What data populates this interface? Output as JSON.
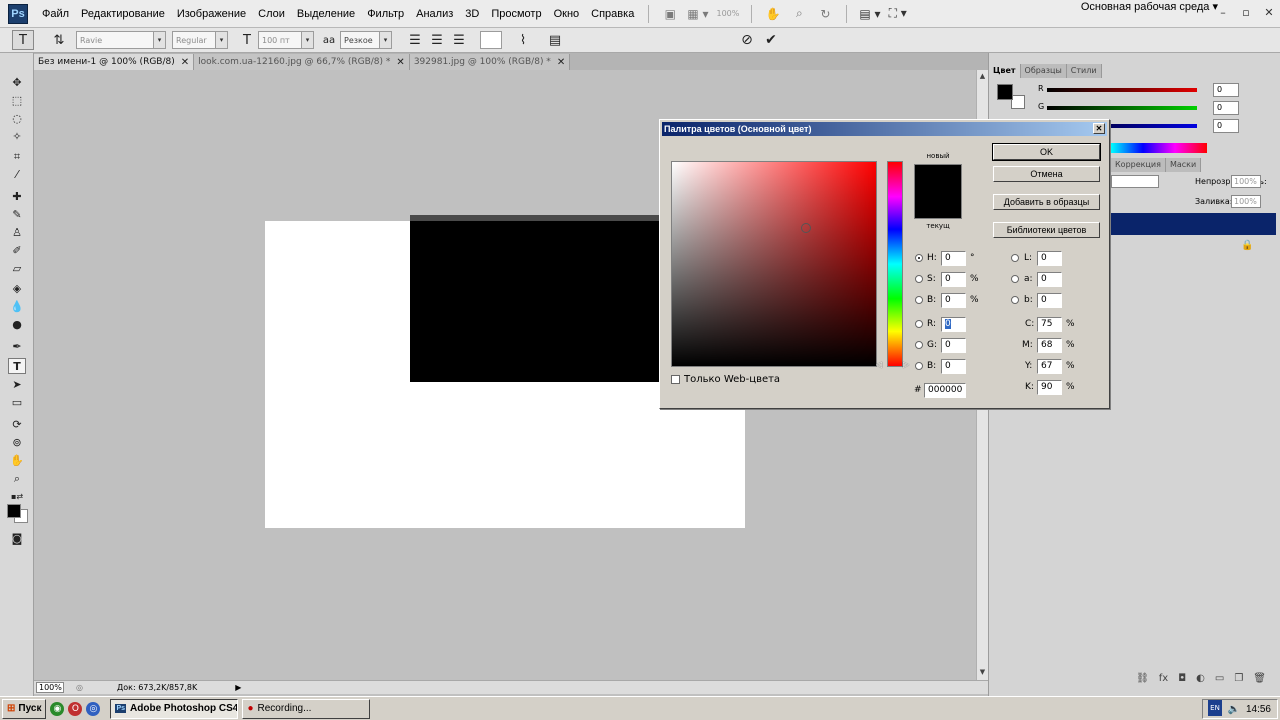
{
  "app": {
    "logo": "Ps",
    "workspace": "Основная рабочая среда"
  },
  "menu": [
    "Файл",
    "Редактирование",
    "Изображение",
    "Слои",
    "Выделение",
    "Фильтр",
    "Анализ",
    "3D",
    "Просмотр",
    "Окно",
    "Справка"
  ],
  "menubar_zoom": "100%",
  "options": {
    "font_family": "Ravie",
    "font_style": "Regular",
    "font_size": "100 пт",
    "aa_label": "aa",
    "antialias": "Резкое"
  },
  "tabs": [
    {
      "label": "Без имени-1 @ 100% (RGB/8)"
    },
    {
      "label": "look.com.ua-12160.jpg @ 66,7% (RGB/8) *"
    },
    {
      "label": "392981.jpg @ 100% (RGB/8) *"
    }
  ],
  "status": {
    "zoom": "100%",
    "doc": "Док: 673,2K/857,8K"
  },
  "color_panel": {
    "tabs": [
      "Цвет",
      "Образцы",
      "Стили"
    ],
    "r_label": "R",
    "g_label": "G",
    "b_label": "B",
    "r": "0",
    "g": "0",
    "b": "0"
  },
  "layers_panel": {
    "tabs": [
      "Коррекция",
      "Маски"
    ],
    "opacity_label": "Непрозрачность:",
    "opacity": "100%",
    "fill_label": "Заливка:",
    "fill": "100%"
  },
  "dialog": {
    "title": "Палитра цветов (Основной цвет)",
    "new_label": "новый",
    "current_label": "текущ",
    "ok": "OK",
    "cancel": "Отмена",
    "add_swatch": "Добавить в образцы",
    "libraries": "Библиотеки цветов",
    "web_only": "Только Web-цвета",
    "fields": {
      "H": "0",
      "S": "0",
      "B": "0",
      "R": "0",
      "G": "0",
      "Bv": "0",
      "L": "0",
      "a": "0",
      "b": "0",
      "C": "75",
      "M": "68",
      "Y": "67",
      "K": "90"
    },
    "hex": "000000",
    "hex_label": "#",
    "deg": "°",
    "pct": "%"
  },
  "taskbar": {
    "start": "Пуск",
    "apps": [
      {
        "label": "Adobe Photoshop CS4...",
        "active": true
      },
      {
        "label": "Recording...",
        "active": false
      }
    ],
    "lang": "EN",
    "time": "14:56"
  }
}
